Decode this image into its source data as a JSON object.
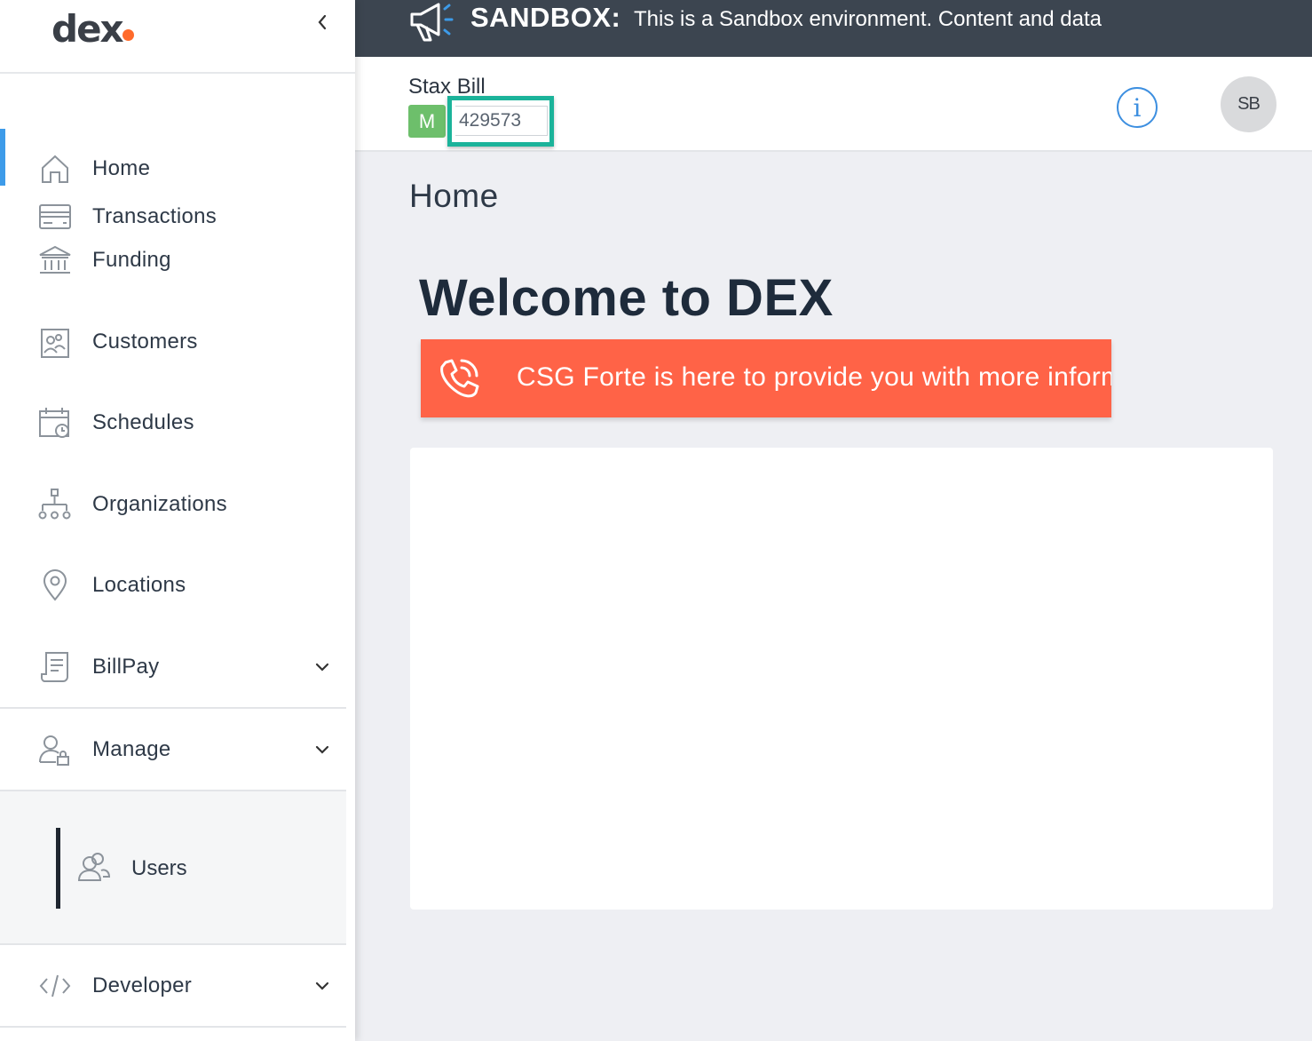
{
  "logo": {
    "text": "dex"
  },
  "banner": {
    "tag": "SANDBOX:",
    "message": "This is a Sandbox environment. Content and data"
  },
  "sidebar": {
    "items": [
      {
        "label": "Home",
        "icon": "home-icon"
      },
      {
        "label": "Transactions",
        "icon": "credit-card-icon"
      },
      {
        "label": "Funding",
        "icon": "bank-icon"
      },
      {
        "label": "Customers",
        "icon": "contact-card-icon"
      },
      {
        "label": "Schedules",
        "icon": "calendar-clock-icon"
      },
      {
        "label": "Organizations",
        "icon": "org-chart-icon"
      },
      {
        "label": "Locations",
        "icon": "map-pin-icon"
      },
      {
        "label": "BillPay",
        "icon": "receipt-icon"
      },
      {
        "label": "Manage",
        "icon": "user-lock-icon"
      },
      {
        "label": "Developer",
        "icon": "code-icon"
      }
    ],
    "submenu": {
      "label": "Users",
      "icon": "users-icon"
    }
  },
  "header": {
    "merchant_name": "Stax Bill",
    "badge": "M",
    "merchant_id": "429573",
    "avatar": "SB",
    "info": "i"
  },
  "main": {
    "page_title": "Home",
    "welcome": "Welcome to DEX",
    "promo": "CSG Forte is here to provide you with more information"
  },
  "colors": {
    "accent": "#3d9be9",
    "banner_bg": "#3c4550",
    "promo_bg": "#ff6347",
    "badge_green": "#6dbf6b",
    "highlight": "#1bb39a",
    "logo_dot": "#ff6a2b"
  }
}
